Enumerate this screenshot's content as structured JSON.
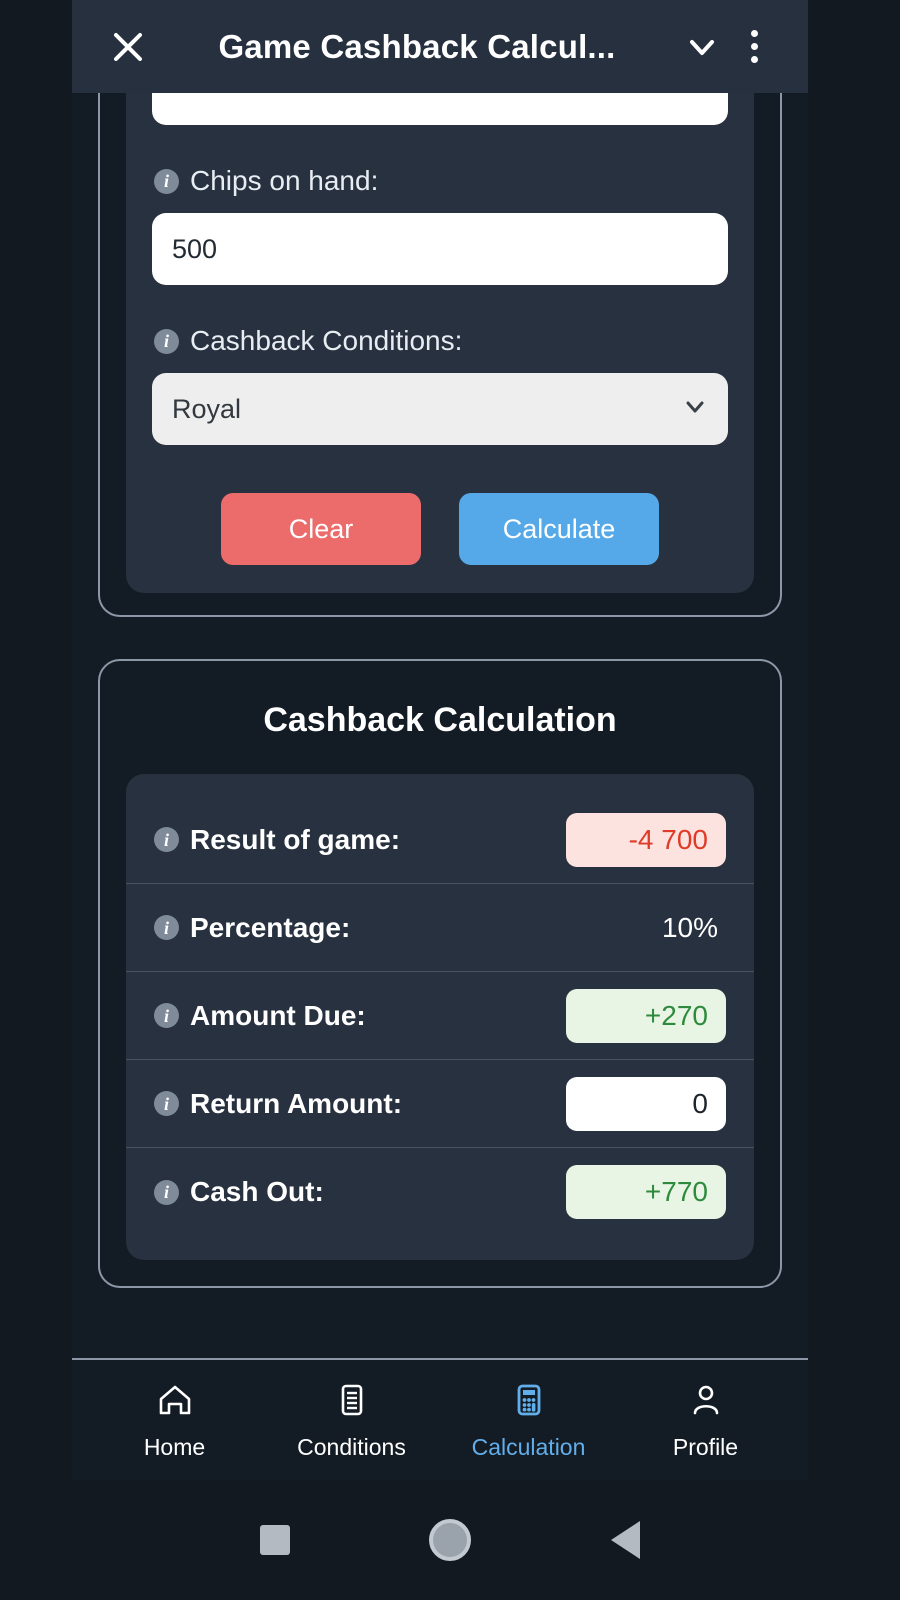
{
  "header": {
    "title": "Game Cashback Calcul...",
    "close_icon": "close-icon",
    "collapse_icon": "chevron-down-icon",
    "menu_icon": "kebab-menu-icon"
  },
  "form": {
    "fields": [
      {
        "label": "Chips on hand:",
        "value": "500",
        "type": "text"
      },
      {
        "label": "Cashback Conditions:",
        "value": "Royal",
        "type": "select"
      }
    ],
    "buttons": {
      "clear": "Clear",
      "calculate": "Calculate"
    },
    "colors": {
      "clear": "#ec6b6b",
      "calculate": "#55a9e8"
    }
  },
  "results": {
    "title": "Cashback Calculation",
    "rows": [
      {
        "label": "Result of game:",
        "value": "-4 700",
        "style": "negative"
      },
      {
        "label": "Percentage:",
        "value": "10%",
        "style": "plain"
      },
      {
        "label": "Amount Due:",
        "value": "+270",
        "style": "positive"
      },
      {
        "label": "Return Amount:",
        "value": "0",
        "style": "input"
      },
      {
        "label": "Cash Out:",
        "value": "+770",
        "style": "positive"
      }
    ],
    "colors": {
      "negative_text": "#e03b28",
      "negative_bg": "#fde3e0",
      "positive_text": "#2e8b3d",
      "positive_bg": "#e8f5e4"
    }
  },
  "bottom_nav": {
    "active": "Calculation",
    "active_color": "#62aeea",
    "items": [
      {
        "label": "Home",
        "icon": "home-icon"
      },
      {
        "label": "Conditions",
        "icon": "document-list-icon"
      },
      {
        "label": "Calculation",
        "icon": "calculator-icon"
      },
      {
        "label": "Profile",
        "icon": "person-icon"
      }
    ]
  },
  "system_nav": {
    "recents": "recents-square-icon",
    "home": "home-circle-icon",
    "back": "back-triangle-icon"
  }
}
